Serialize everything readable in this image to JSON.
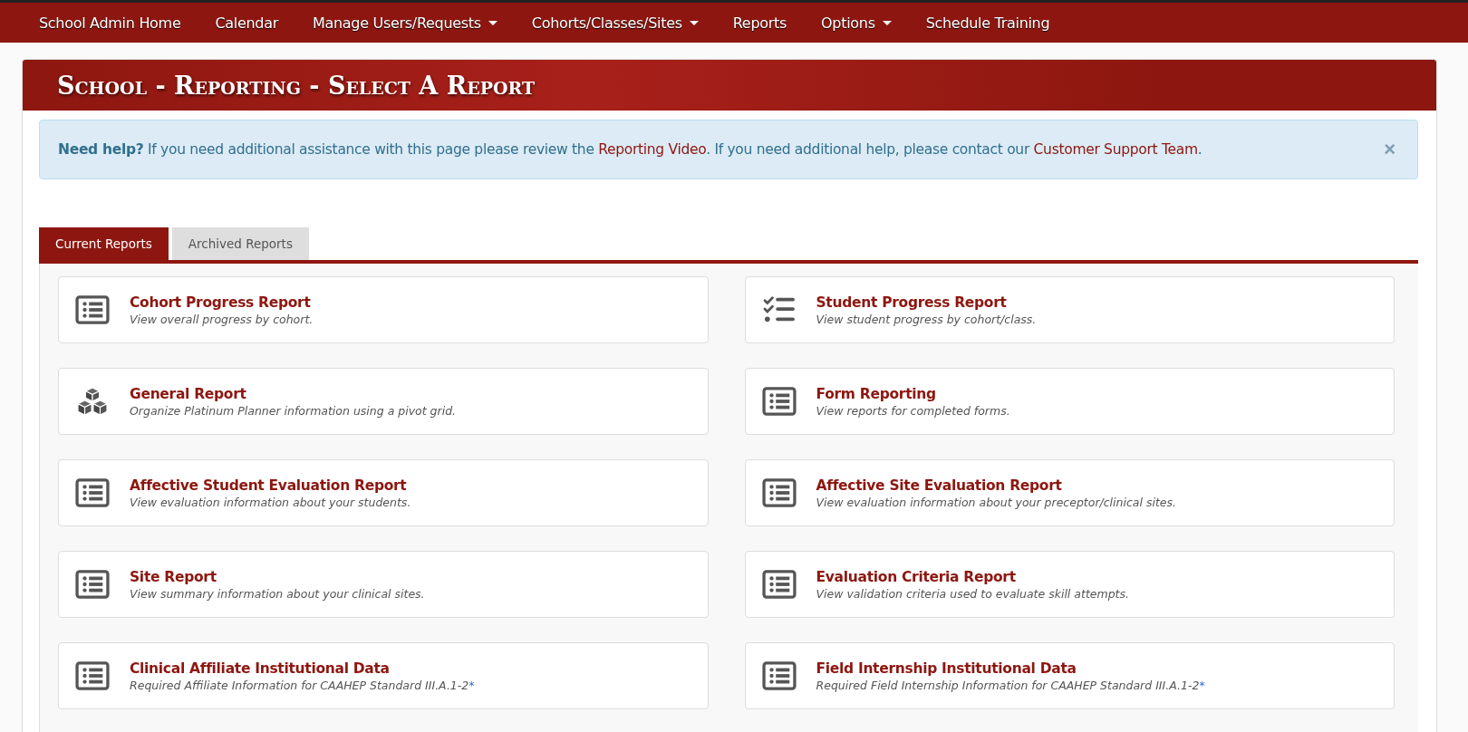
{
  "nav": [
    {
      "label": "School Admin Home",
      "dropdown": false
    },
    {
      "label": "Calendar",
      "dropdown": false
    },
    {
      "label": "Manage Users/Requests",
      "dropdown": true
    },
    {
      "label": "Cohorts/Classes/Sites",
      "dropdown": true
    },
    {
      "label": "Reports",
      "dropdown": false
    },
    {
      "label": "Options",
      "dropdown": true
    },
    {
      "label": "Schedule Training",
      "dropdown": false
    }
  ],
  "panel_title": "School - Reporting - Select A Report",
  "alert": {
    "parts": [
      {
        "kind": "bold",
        "text": "Need help?"
      },
      {
        "kind": "text",
        "text": " If you need additional assistance with this page please review the "
      },
      {
        "kind": "link",
        "text": "Reporting Video"
      },
      {
        "kind": "text",
        "text": ". If you need additional help, please contact our "
      },
      {
        "kind": "link",
        "text": "Customer Support Team"
      },
      {
        "kind": "text",
        "text": "."
      }
    ],
    "close": "×"
  },
  "tabs": [
    {
      "label": "Current Reports",
      "selected": true
    },
    {
      "label": "Archived Reports",
      "selected": false
    }
  ],
  "reports": [
    {
      "kind": "list",
      "title": "Cohort Progress Report",
      "description": "View overall progress by cohort."
    },
    {
      "kind": "checklist",
      "title": "Student Progress Report",
      "description": "View student progress by cohort/class."
    },
    {
      "kind": "cubes",
      "title": "General Report",
      "description": "Organize Platinum Planner information using a pivot grid."
    },
    {
      "kind": "list",
      "title": "Form Reporting",
      "description": "View reports for completed forms."
    },
    {
      "kind": "list",
      "title": "Affective Student Evaluation Report",
      "description": "View evaluation information about your students."
    },
    {
      "kind": "list",
      "title": "Affective Site Evaluation Report",
      "description": "View evaluation information about your preceptor/clinical sites."
    },
    {
      "kind": "list",
      "title": "Site Report",
      "description": "View summary information about your clinical sites."
    },
    {
      "kind": "list",
      "title": "Evaluation Criteria Report",
      "description": "View validation criteria used to evaluate skill attempts."
    },
    {
      "kind": "list",
      "title": "Clinical Affiliate Institutional Data",
      "description": "Required Affiliate Information for CAAHEP Standard III.A.1-2",
      "note_mark": "*"
    },
    {
      "kind": "list",
      "title": "Field Internship Institutional Data",
      "description": "Required Field Internship Information for CAAHEP Standard III.A.1-2",
      "note_mark": "*"
    }
  ]
}
